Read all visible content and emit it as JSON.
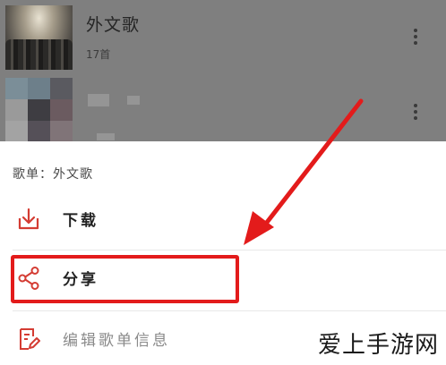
{
  "playlists": [
    {
      "title": "外文歌",
      "count": "17首",
      "cover_icon": "concert-photo"
    },
    {
      "title": "",
      "count": "",
      "cover_icon": "blurred-mosaic"
    }
  ],
  "sheet": {
    "header": "歌单：外文歌",
    "items": [
      {
        "label": "下载",
        "icon": "download-icon"
      },
      {
        "label": "分享",
        "icon": "share-icon"
      },
      {
        "label": "编辑歌单信息",
        "icon": "edit-icon"
      }
    ]
  },
  "annotation": {
    "color": "#e31b1b",
    "target": "share"
  },
  "watermark": "爱上手游网",
  "colors": {
    "accent_red": "#e31b1b",
    "icon_red": "#d43c33",
    "overlay": "#7f7f7f"
  }
}
